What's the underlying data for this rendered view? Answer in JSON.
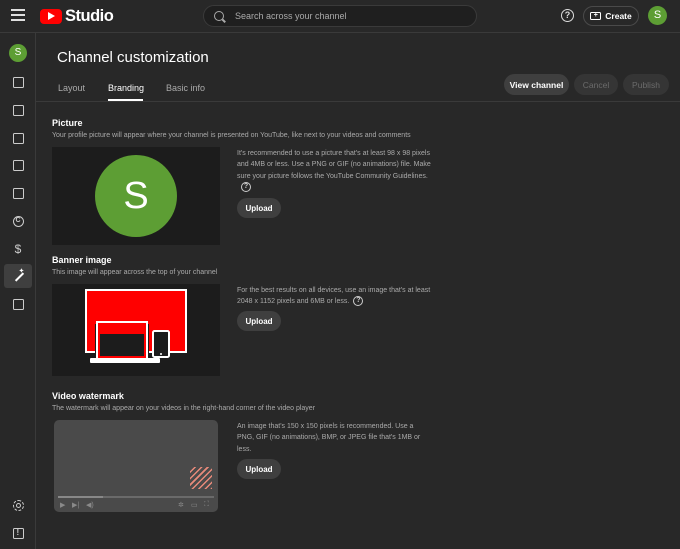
{
  "app": {
    "logo_text": "Studio",
    "avatar_letter": "S"
  },
  "search": {
    "placeholder": "Search across your channel"
  },
  "topbar": {
    "help_glyph": "?",
    "create_label": "Create"
  },
  "sidebar": {
    "avatar_letter": "S",
    "items": [
      {
        "name": "dashboard",
        "icon": "dashboard-icon"
      },
      {
        "name": "content",
        "icon": "content-icon"
      },
      {
        "name": "analytics",
        "icon": "analytics-icon"
      },
      {
        "name": "comments",
        "icon": "comments-icon"
      },
      {
        "name": "subtitles",
        "icon": "subtitles-icon"
      },
      {
        "name": "copyright",
        "icon": "copyright-icon",
        "glyph": "C"
      },
      {
        "name": "earn",
        "icon": "earn-icon",
        "glyph": "$"
      },
      {
        "name": "customization",
        "icon": "customization-icon",
        "active": true
      },
      {
        "name": "audio-library",
        "icon": "audio-library-icon"
      }
    ],
    "bottom": [
      {
        "name": "settings",
        "icon": "gear-icon"
      },
      {
        "name": "feedback",
        "icon": "feedback-icon"
      }
    ]
  },
  "page": {
    "title": "Channel customization",
    "tabs": [
      {
        "label": "Layout",
        "active": false
      },
      {
        "label": "Branding",
        "active": true
      },
      {
        "label": "Basic info",
        "active": false
      }
    ],
    "actions": {
      "view": "View channel",
      "cancel": "Cancel",
      "publish": "Publish"
    }
  },
  "sections": {
    "picture": {
      "title": "Picture",
      "desc": "Your profile picture will appear where your channel is presented on YouTube, like next to your videos and comments",
      "avatar_letter": "S",
      "info": "It's recommended to use a picture that's at least 98 x 98 pixels and 4MB or less. Use a PNG or GIF (no animations) file. Make sure your picture follows the YouTube Community Guidelines.",
      "upload": "Upload"
    },
    "banner": {
      "title": "Banner image",
      "desc": "This image will appear across the top of your channel",
      "info": "For the best results on all devices, use an image that's at least 2048 x 1152 pixels and 6MB or less.",
      "upload": "Upload"
    },
    "watermark": {
      "title": "Video watermark",
      "desc": "The watermark will appear on your videos in the right-hand corner of the video player",
      "info": "An image that's 150 x 150 pixels is recommended. Use a PNG, GIF (no animations), BMP, or JPEG file that's 1MB or less.",
      "upload": "Upload"
    }
  },
  "colors": {
    "accent_red": "#ff0000",
    "avatar_green": "#5d9e34",
    "watermark_stripes": "#e98a7a"
  }
}
